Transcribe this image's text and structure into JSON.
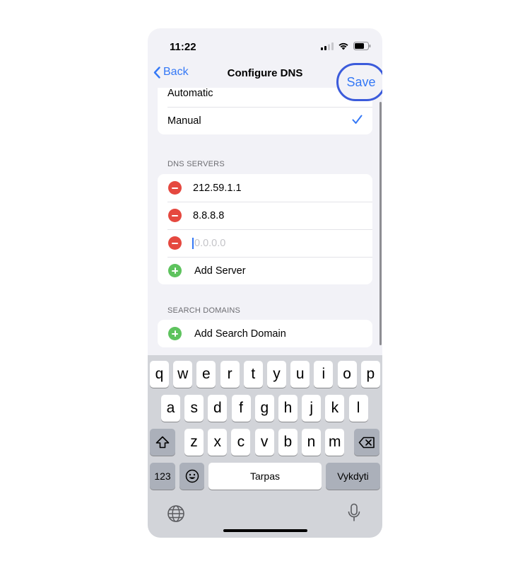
{
  "status": {
    "time": "11:22"
  },
  "nav": {
    "back_label": "Back",
    "title": "Configure DNS",
    "save_label": "Save"
  },
  "config_mode": {
    "options": [
      {
        "label": "Automatic",
        "selected": false
      },
      {
        "label": "Manual",
        "selected": true
      }
    ]
  },
  "dns_servers": {
    "header": "DNS SERVERS",
    "servers": [
      "212.59.1.1",
      "8.8.8.8"
    ],
    "new_server_placeholder": "0.0.0.0",
    "add_label": "Add Server"
  },
  "search_domains": {
    "header": "SEARCH DOMAINS",
    "add_label": "Add Search Domain"
  },
  "keyboard": {
    "row1": [
      "q",
      "w",
      "e",
      "r",
      "t",
      "y",
      "u",
      "i",
      "o",
      "p"
    ],
    "row2": [
      "a",
      "s",
      "d",
      "f",
      "g",
      "h",
      "j",
      "k",
      "l"
    ],
    "row3": [
      "z",
      "x",
      "c",
      "v",
      "b",
      "n",
      "m"
    ],
    "numbers_label": "123",
    "space_label": "Tarpas",
    "return_label": "Vykdyti"
  },
  "colors": {
    "accent": "#3478f6",
    "minus": "#e5483f",
    "plus": "#5ec35e",
    "highlight_ring": "#3b5bdb"
  }
}
